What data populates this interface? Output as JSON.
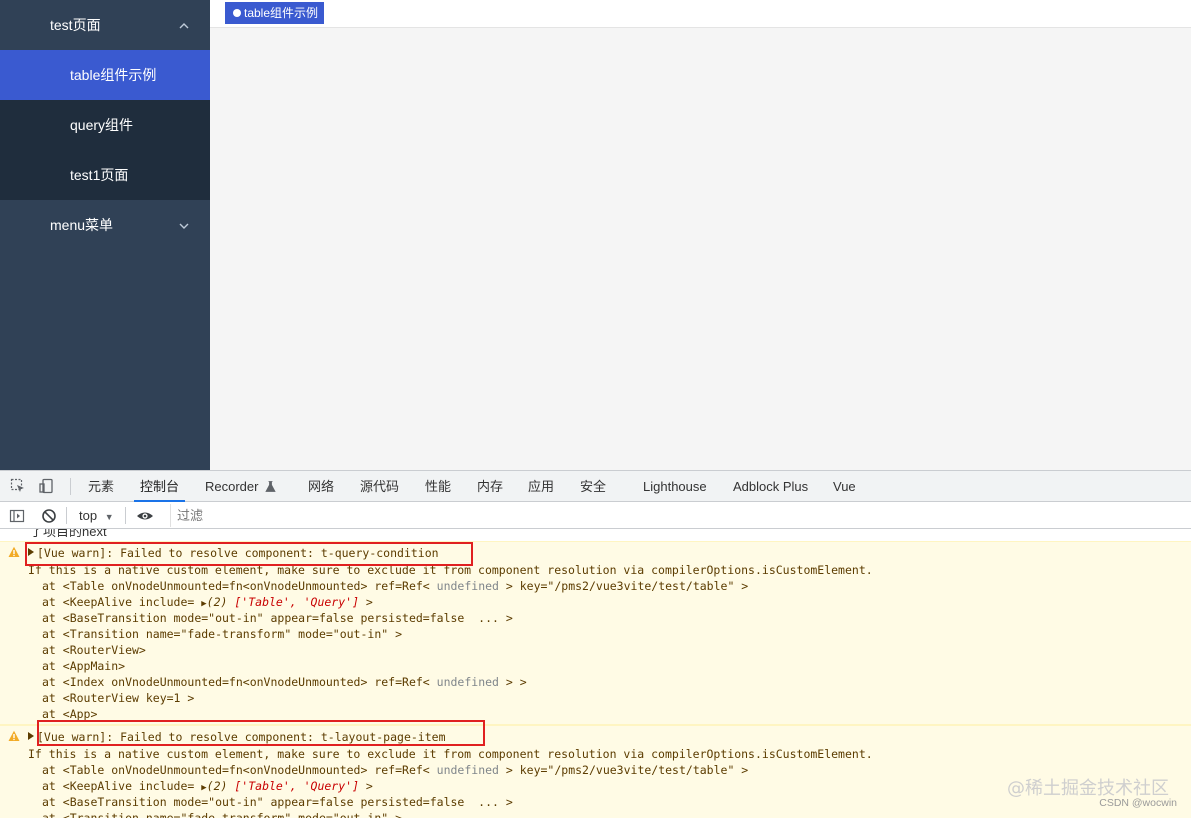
{
  "sidebar": {
    "groups": [
      {
        "label": "test页面",
        "expanded": true,
        "items": [
          {
            "label": "table组件示例",
            "active": true
          },
          {
            "label": "query组件",
            "active": false
          },
          {
            "label": "test1页面",
            "active": false
          }
        ]
      },
      {
        "label": "menu菜单",
        "expanded": false,
        "items": []
      }
    ]
  },
  "tags": [
    {
      "label": "table组件示例",
      "active": true
    }
  ],
  "devtools": {
    "tabs": [
      "元素",
      "控制台",
      "Recorder",
      "网络",
      "源代码",
      "性能",
      "内存",
      "应用",
      "安全",
      "Lighthouse",
      "Adblock Plus",
      "Vue"
    ],
    "active_tab": "控制台",
    "context": "top",
    "filter_placeholder": "过滤",
    "partial_line": "了项目的next",
    "warnings": [
      {
        "head": "[Vue warn]: Failed to resolve component: t-query-condition",
        "detail": "If this is a native custom element, make sure to exclude it from component resolution via compilerOptions.isCustomElement.",
        "stack": [
          "at <Table onVnodeUnmounted=fn<onVnodeUnmounted> ref=Ref< |undefined| > key=\"/pms2/vue3vite/test/table\" >",
          "at <KeepAlive include= ▶(2) ['Table', 'Query'] >",
          "at <BaseTransition mode=\"out-in\" appear=false persisted=false  ... >",
          "at <Transition name=\"fade-transform\" mode=\"out-in\" >",
          "at <RouterView>",
          "at <AppMain>",
          "at <Index onVnodeUnmounted=fn<onVnodeUnmounted> ref=Ref< |undefined| > >",
          "at <RouterView key=1 >",
          "at <App>"
        ]
      },
      {
        "head": "[Vue warn]: Failed to resolve component: t-layout-page-item",
        "detail": "If this is a native custom element, make sure to exclude it from component resolution via compilerOptions.isCustomElement.",
        "stack": [
          "at <Table onVnodeUnmounted=fn<onVnodeUnmounted> ref=Ref< |undefined| > key=\"/pms2/vue3vite/test/table\" >",
          "at <KeepAlive include= ▶(2) ['Table', 'Query'] >",
          "at <BaseTransition mode=\"out-in\" appear=false persisted=false  ... >",
          "at <Transition name=\"fade-transform\" mode=\"out-in\" >"
        ]
      }
    ]
  },
  "watermark": "@稀土掘金技术社区",
  "credit": "CSDN @wocwin",
  "colors": {
    "sidebar_bg": "#304156",
    "submenu_bg": "#1f2d3d",
    "active": "#3a5ad0",
    "warn_bg": "#fffbe5",
    "highlight": "#e02020"
  }
}
